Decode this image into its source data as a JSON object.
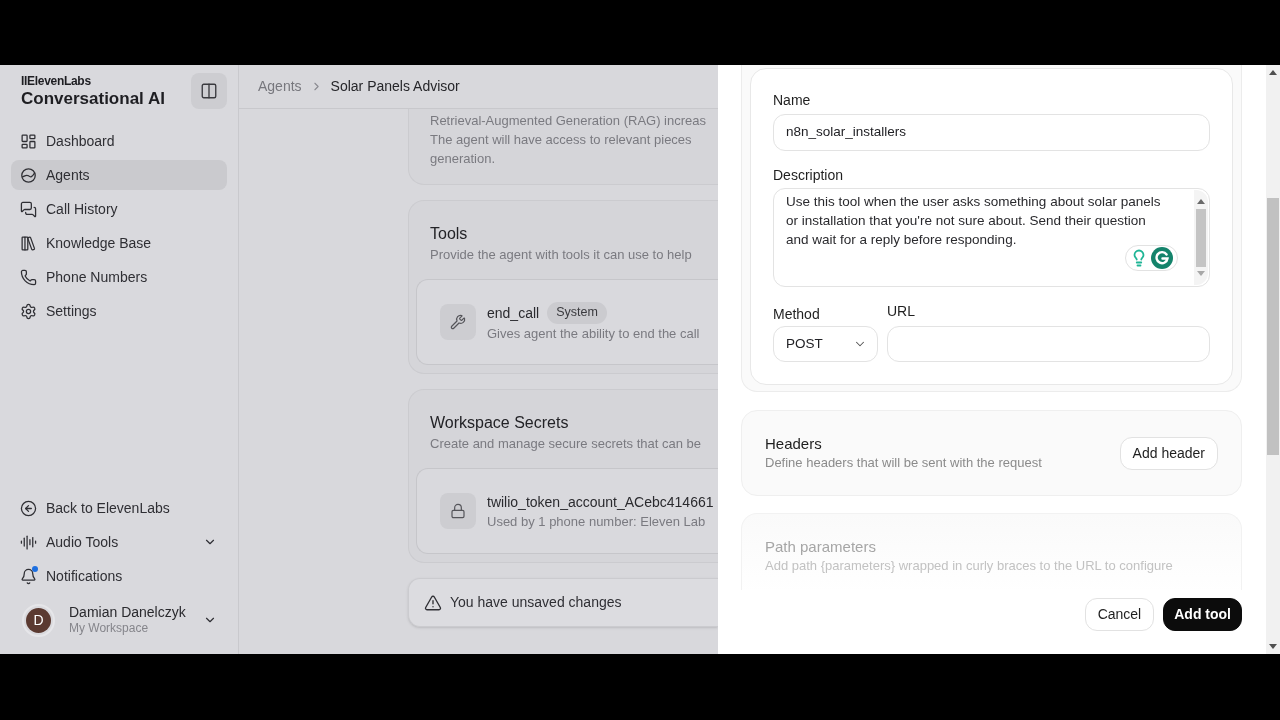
{
  "sidebar": {
    "brand": "IIElevenLabs",
    "product": "Conversational AI",
    "nav": [
      {
        "label": "Dashboard",
        "selected": false
      },
      {
        "label": "Agents",
        "selected": true
      },
      {
        "label": "Call History",
        "selected": false
      },
      {
        "label": "Knowledge Base",
        "selected": false
      },
      {
        "label": "Phone Numbers",
        "selected": false
      },
      {
        "label": "Settings",
        "selected": false
      }
    ],
    "footer_items": [
      {
        "label": "Back to ElevenLabs",
        "expandable": false,
        "has_dot": false
      },
      {
        "label": "Audio Tools",
        "expandable": true,
        "has_dot": false
      },
      {
        "label": "Notifications",
        "expandable": false,
        "has_dot": true
      }
    ],
    "user": {
      "initial": "D",
      "name": "Damian Danelczyk",
      "workspace": "My Workspace",
      "expandable": true
    }
  },
  "breadcrumb": [
    {
      "label": "Agents",
      "current": false
    },
    {
      "label": "Solar Panels Advisor",
      "current": true
    }
  ],
  "knowledge_card": {
    "description_lines": [
      "Retrieval-Augmented Generation (RAG) increas",
      "The agent will have access to relevant pieces",
      "generation."
    ]
  },
  "tools_card": {
    "title": "Tools",
    "subtitle": "Provide the agent with tools it can use to help",
    "items": [
      {
        "name": "end_call",
        "badge": "System",
        "description": "Gives agent the ability to end the call"
      }
    ]
  },
  "secrets_card": {
    "title": "Workspace Secrets",
    "subtitle": "Create and manage secure secrets that can be",
    "items": [
      {
        "name": "twilio_token_account_ACebc414661",
        "description": "Used by 1 phone number: Eleven Lab"
      }
    ]
  },
  "unsaved_bar": {
    "message": "You have unsaved changes"
  },
  "tool_form": {
    "name": {
      "label": "Name",
      "value": "n8n_solar_installers"
    },
    "description": {
      "label": "Description",
      "value": "Use this tool when the user asks something about solar panels or installation that you're not sure about. Send their question and wait for a reply before responding."
    },
    "method": {
      "label": "Method",
      "value": "POST"
    },
    "url": {
      "label": "URL"
    }
  },
  "headers_section": {
    "title": "Headers",
    "description": "Define headers that will be sent with the request",
    "button": "Add header"
  },
  "path_parameters_section": {
    "title": "Path parameters",
    "description": "Add path {parameters} wrapped in curly braces to the URL to configure"
  },
  "footer_buttons": [
    {
      "label": "Cancel",
      "kind": "secondary"
    },
    {
      "label": "Add tool",
      "kind": "primary"
    }
  ]
}
